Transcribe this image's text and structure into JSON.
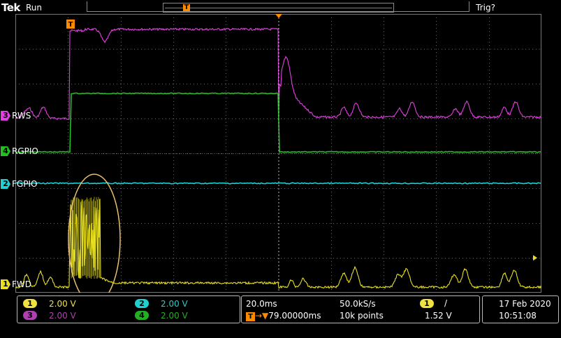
{
  "header": {
    "brand": "Tek",
    "acq_state": "Run",
    "trigger_state": "Trig?",
    "record_view_marker": "T"
  },
  "trigger_marker": "T",
  "channels": [
    {
      "number": "3",
      "label": "RWS",
      "color": "#e040e0"
    },
    {
      "number": "4",
      "label": "RGPIO",
      "color": "#22c022"
    },
    {
      "number": "2",
      "label": "FGPIO",
      "color": "#20d0d0"
    },
    {
      "number": "1",
      "label": "FWD",
      "color": "#e8e020"
    }
  ],
  "highlight_color": "#e8c070",
  "readouts": {
    "ch1": {
      "badge": "1",
      "scale": "2.00 V",
      "color": "#f0e040"
    },
    "ch2": {
      "badge": "2",
      "scale": "2.00 V",
      "color": "#20d0d0"
    },
    "ch3": {
      "badge": "3",
      "scale": "2.00 V",
      "color": "#b040b0"
    },
    "ch4": {
      "badge": "4",
      "scale": "2.00 V",
      "color": "#22b022"
    },
    "horizontal": {
      "time_per_div": "20.0ms",
      "sample_rate": "50.0kS/s",
      "trigger_pos_badge": "T",
      "trigger_delay": "79.00000ms",
      "record_length": "10k points"
    },
    "trigger": {
      "source_badge": "1",
      "slope": "/",
      "level": "1.52 V"
    },
    "clock": {
      "date": "17 Feb  2020",
      "time": "10:51:08"
    }
  }
}
